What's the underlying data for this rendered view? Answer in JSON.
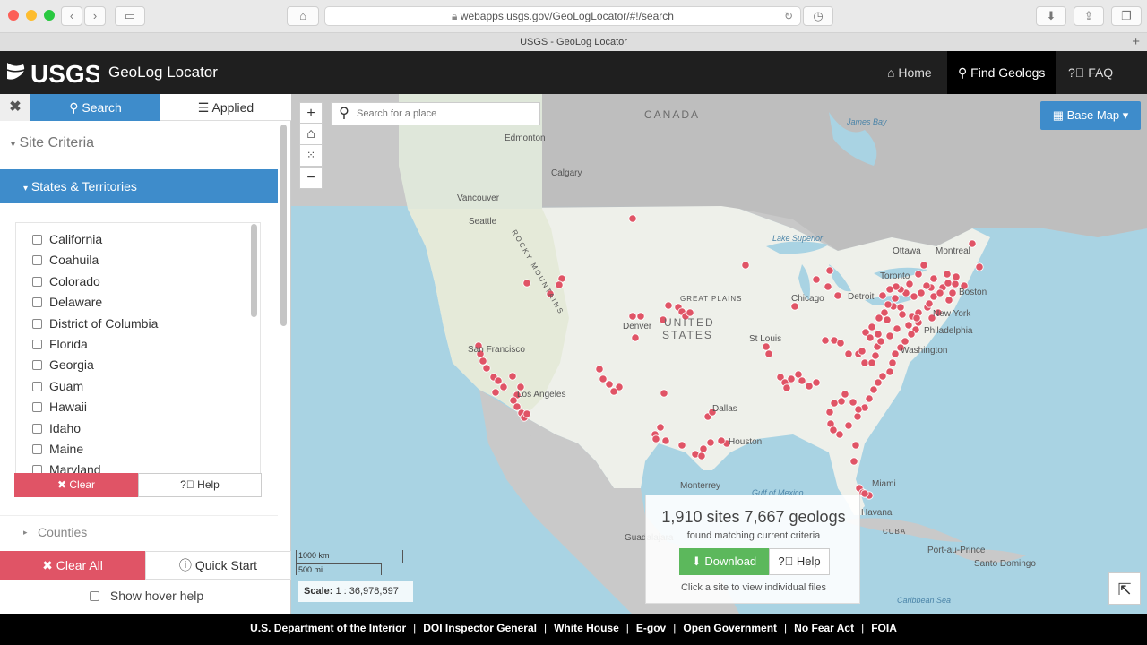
{
  "browser": {
    "url": "webapps.usgs.gov/GeoLogLocator/#!/search",
    "tab_title": "USGS - GeoLog Locator"
  },
  "header": {
    "logo_text": "USGS",
    "app_title": "GeoLog Locator",
    "nav": [
      {
        "label": "Home",
        "icon": "home-icon",
        "active": false
      },
      {
        "label": "Find Geologs",
        "icon": "search-icon",
        "active": true
      },
      {
        "label": "FAQ",
        "icon": "question-icon",
        "active": false
      }
    ]
  },
  "sidebar": {
    "close_glyph": "✖",
    "tabs": [
      {
        "label": "Search",
        "icon": "search-icon",
        "active": true
      },
      {
        "label": "Applied",
        "icon": "list-icon",
        "active": false
      }
    ],
    "site_criteria": "Site Criteria",
    "states_header": "States & Territories",
    "states": [
      "California",
      "Coahuila",
      "Colorado",
      "Delaware",
      "District of Columbia",
      "Florida",
      "Georgia",
      "Guam",
      "Hawaii",
      "Idaho",
      "Maine",
      "Maryland"
    ],
    "clear_label": "Clear",
    "help_label": "Help",
    "counties_label": "Counties",
    "clear_all_label": "Clear All",
    "quick_start_label": "Quick Start",
    "hover_help_label": "Show hover help"
  },
  "map": {
    "search_placeholder": "Search for a place",
    "basemap_label": "Base Map",
    "scale_km": "1000 km",
    "scale_mi": "500 mi",
    "scale_label": "Scale:",
    "scale_value": "1 : 36,978,597",
    "labels": {
      "canada": "CANADA",
      "us": "UNITED",
      "states": "STATES",
      "edmonton": "Edmonton",
      "calgary": "Calgary",
      "vancouver": "Vancouver",
      "seattle": "Seattle",
      "san_francisco": "San Francisco",
      "los_angeles": "Los Angeles",
      "denver": "Denver",
      "great_plains": "GREAT PLAINS",
      "chicago": "Chicago",
      "detroit": "Detroit",
      "toronto": "Toronto",
      "ottawa": "Ottawa",
      "montreal": "Montreal",
      "boston": "Boston",
      "new_york": "New York",
      "philadelphia": "Philadelphia",
      "washington": "Washington",
      "st_louis": "St Louis",
      "dallas": "Dallas",
      "houston": "Houston",
      "miami": "Miami",
      "havana": "Havana",
      "monterrey": "Monterrey",
      "guadalajara": "Guadalajara",
      "port_au_prince": "Port-au-Prince",
      "santo_domingo": "Santo Domingo",
      "lake_superior": "Lake Superior",
      "james_bay": "James Bay",
      "gulf_of_mexico": "Gulf of Mexico",
      "caribbean_sea": "Caribbean Sea",
      "rocky_mountains": "ROCKY MOUNTAINS",
      "cuba": "CUBA"
    },
    "results": {
      "count_text": "1,910 sites 7,667 geologs",
      "subtext": "found matching current criteria",
      "download_label": "Download",
      "help_label": "Help",
      "hint": "Click a site to view individual files"
    },
    "colors": {
      "site": "#e05466",
      "accent": "#3e8ccb"
    }
  },
  "footer": {
    "links": [
      "U.S. Department of the Interior",
      "DOI Inspector General",
      "White House",
      "E-gov",
      "Open Government",
      "No Fear Act",
      "FOIA"
    ]
  }
}
